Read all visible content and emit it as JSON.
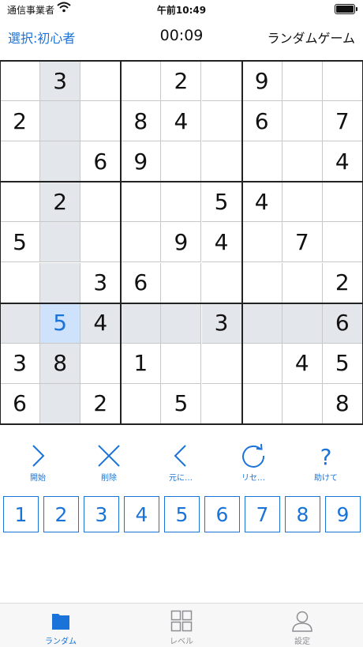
{
  "status_bar": {
    "carrier": "通信事業者",
    "time": "午前10:49"
  },
  "header": {
    "level_label": "選択:初心者",
    "timer": "00:09",
    "mode_label": "ランダムゲーム"
  },
  "board": {
    "grid": [
      [
        "",
        "3",
        "",
        "",
        "2",
        "",
        "9",
        "",
        ""
      ],
      [
        "2",
        "",
        "",
        "8",
        "4",
        "",
        "6",
        "",
        "7"
      ],
      [
        "",
        "",
        "6",
        "9",
        "",
        "",
        "",
        "",
        "4"
      ],
      [
        "",
        "2",
        "",
        "",
        "",
        "5",
        "4",
        "",
        ""
      ],
      [
        "5",
        "",
        "",
        "",
        "9",
        "4",
        "",
        "7",
        ""
      ],
      [
        "",
        "",
        "3",
        "6",
        "",
        "",
        "",
        "",
        "2"
      ],
      [
        "",
        "5",
        "4",
        "",
        "",
        "3",
        "",
        "",
        "6"
      ],
      [
        "3",
        "8",
        "",
        "1",
        "",
        "",
        "",
        "4",
        "5"
      ],
      [
        "6",
        "",
        "2",
        "",
        "5",
        "",
        "",
        "",
        "8"
      ]
    ],
    "selected": {
      "row": 6,
      "col": 1
    }
  },
  "actions": [
    {
      "id": "start",
      "label": "開始",
      "icon": "chevron-right-icon"
    },
    {
      "id": "delete",
      "label": "削除",
      "icon": "x-icon"
    },
    {
      "id": "undo",
      "label": "元に…",
      "icon": "chevron-left-icon"
    },
    {
      "id": "reset",
      "label": "リセ…",
      "icon": "refresh-icon"
    },
    {
      "id": "help",
      "label": "助けて",
      "icon": "question-icon"
    }
  ],
  "numpad": [
    "1",
    "2",
    "3",
    "4",
    "5",
    "6",
    "7",
    "8",
    "9"
  ],
  "tabs": [
    {
      "id": "random",
      "label": "ランダム",
      "icon": "folder-icon",
      "active": true
    },
    {
      "id": "level",
      "label": "レベル",
      "icon": "grid-icon",
      "active": false
    },
    {
      "id": "settings",
      "label": "設定",
      "icon": "person-icon",
      "active": false
    }
  ],
  "colors": {
    "accent": "#1a73d8",
    "highlight": "#e3e6eb",
    "selected": "#cfe2fb"
  }
}
